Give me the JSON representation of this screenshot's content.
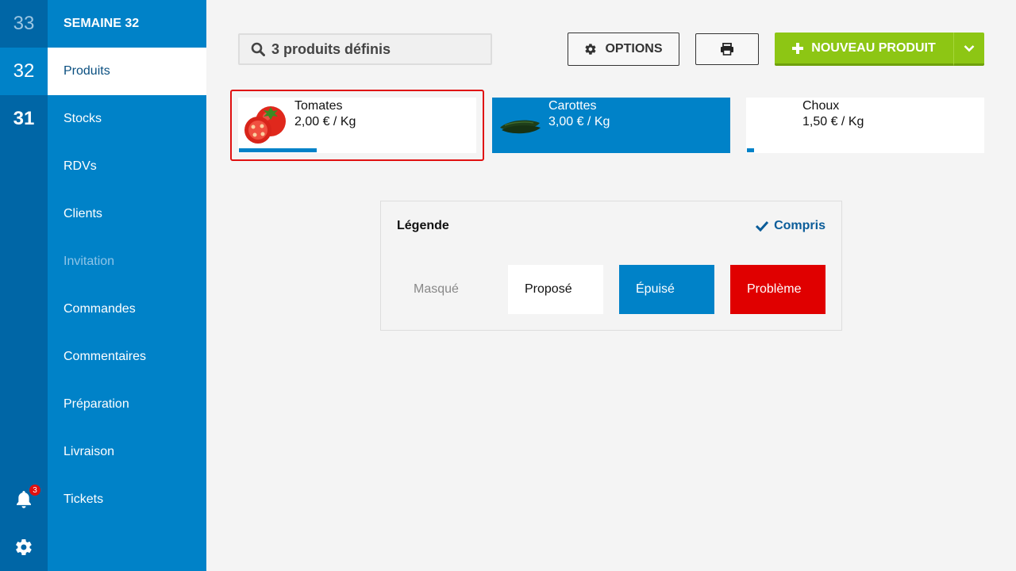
{
  "weeks": [
    "33",
    "32",
    "31"
  ],
  "menu": {
    "header": "SEMAINE 32",
    "items": [
      {
        "label": "Produits"
      },
      {
        "label": "Stocks"
      },
      {
        "label": "RDVs"
      },
      {
        "label": "Clients"
      },
      {
        "label": "Invitation"
      },
      {
        "label": "Commandes"
      },
      {
        "label": "Commentaires"
      },
      {
        "label": "Préparation"
      },
      {
        "label": "Livraison"
      },
      {
        "label": "Tickets"
      }
    ]
  },
  "notifications": {
    "count": "3"
  },
  "toolbar": {
    "search_text": "3 produits définis",
    "options_label": "OPTIONS",
    "new_product_label": "NOUVEAU PRODUIT"
  },
  "products": [
    {
      "name": "Tomates",
      "price": "2,00 € / Kg",
      "status": "proposed",
      "progress": 0.33,
      "icon": "tomato-image"
    },
    {
      "name": "Carottes",
      "price": "3,00 € / Kg",
      "status": "sold-out",
      "progress": 0,
      "icon": "carrots-image"
    },
    {
      "name": "Choux",
      "price": "1,50 € / Kg",
      "status": "proposed",
      "progress": 0.03,
      "icon": ""
    }
  ],
  "legend": {
    "title": "Légende",
    "ok_label": "Compris",
    "items": [
      {
        "label": "Masqué"
      },
      {
        "label": "Proposé"
      },
      {
        "label": "Épuisé"
      },
      {
        "label": "Problème"
      }
    ]
  },
  "colors": {
    "rail": "#0066a6",
    "menu": "#0082c8",
    "accent_green": "#8dc614",
    "problem_red": "#e00000",
    "selection_red": "#e01010"
  }
}
